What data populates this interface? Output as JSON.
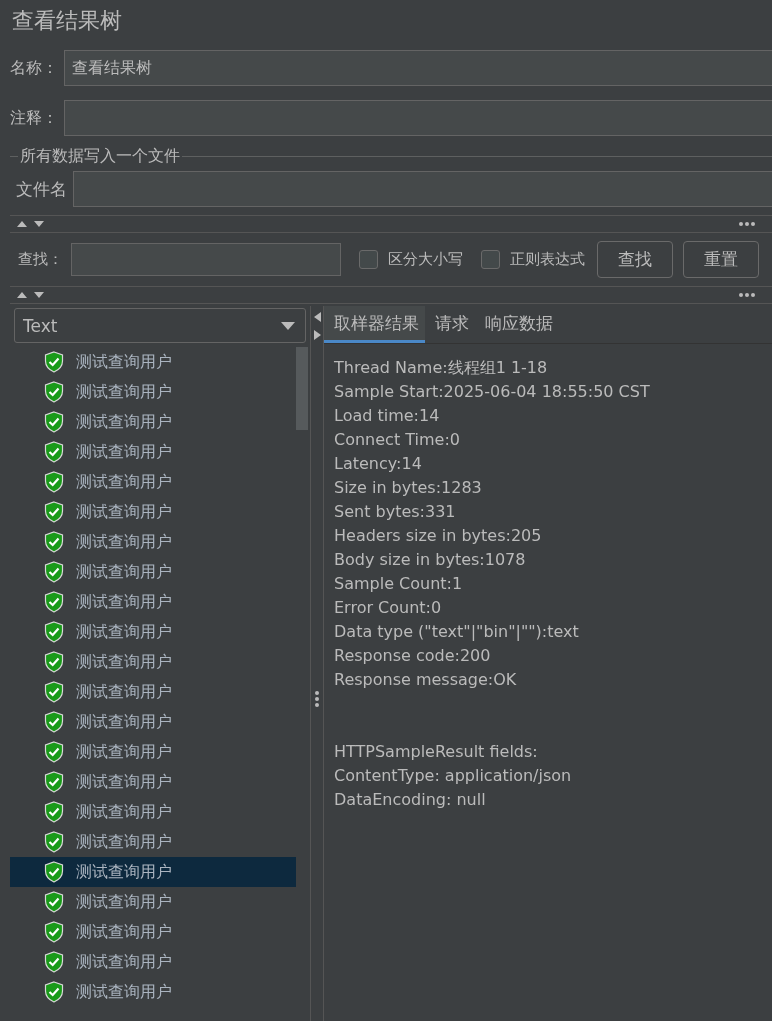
{
  "title": "查看结果树",
  "name_field": {
    "label": "名称：",
    "value": "查看结果树"
  },
  "comment_field": {
    "label": "注释："
  },
  "file_group": {
    "legend": "所有数据写入一个文件",
    "label": "文件名"
  },
  "search": {
    "label": "查找：",
    "options": [
      {
        "label": "区分大小写",
        "checked": false
      },
      {
        "label": "正则表达式",
        "checked": false
      }
    ],
    "buttons": [
      "查找",
      "重置"
    ]
  },
  "renderer": {
    "value": "Text"
  },
  "results": [
    {
      "label": "测试查询用户",
      "selected": false
    },
    {
      "label": "测试查询用户",
      "selected": false
    },
    {
      "label": "测试查询用户",
      "selected": false
    },
    {
      "label": "测试查询用户",
      "selected": false
    },
    {
      "label": "测试查询用户",
      "selected": false
    },
    {
      "label": "测试查询用户",
      "selected": false
    },
    {
      "label": "测试查询用户",
      "selected": false
    },
    {
      "label": "测试查询用户",
      "selected": false
    },
    {
      "label": "测试查询用户",
      "selected": false
    },
    {
      "label": "测试查询用户",
      "selected": false
    },
    {
      "label": "测试查询用户",
      "selected": false
    },
    {
      "label": "测试查询用户",
      "selected": false
    },
    {
      "label": "测试查询用户",
      "selected": false
    },
    {
      "label": "测试查询用户",
      "selected": false
    },
    {
      "label": "测试查询用户",
      "selected": false
    },
    {
      "label": "测试查询用户",
      "selected": false
    },
    {
      "label": "测试查询用户",
      "selected": false
    },
    {
      "label": "测试查询用户",
      "selected": true
    },
    {
      "label": "测试查询用户",
      "selected": false
    },
    {
      "label": "测试查询用户",
      "selected": false
    },
    {
      "label": "测试查询用户",
      "selected": false
    },
    {
      "label": "测试查询用户",
      "selected": false
    }
  ],
  "tabs": [
    {
      "label": "取样器结果",
      "selected": true
    },
    {
      "label": "请求",
      "selected": false
    },
    {
      "label": "响应数据",
      "selected": false
    }
  ],
  "sample_result": [
    "Thread Name:线程组1 1-18",
    "Sample Start:2025-06-04 18:55:50 CST",
    "Load time:14",
    "Connect Time:0",
    "Latency:14",
    "Size in bytes:1283",
    "Sent bytes:331",
    "Headers size in bytes:205",
    "Body size in bytes:1078",
    "Sample Count:1",
    "Error Count:0",
    "Data type (\"text\"|\"bin\"|\"\"):text",
    "Response code:200",
    "Response message:OK"
  ],
  "http_fields": [
    "HTTPSampleResult fields:",
    "ContentType: application/json",
    "DataEncoding: null"
  ]
}
